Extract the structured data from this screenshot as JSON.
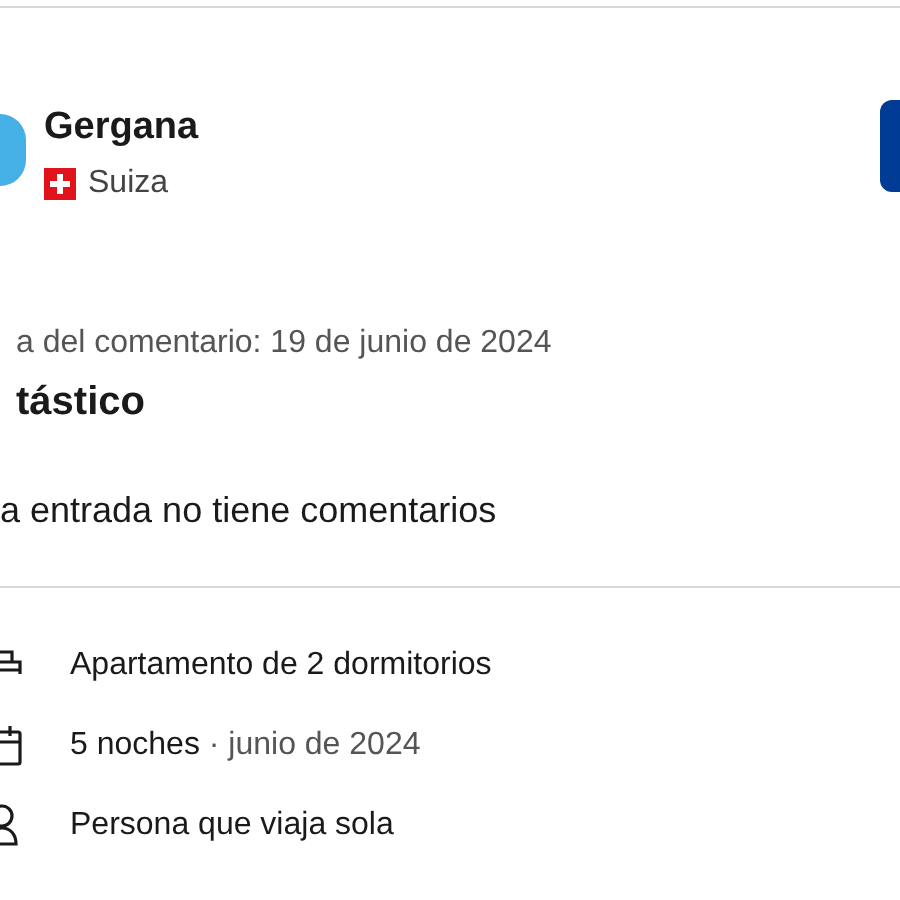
{
  "reviewer": {
    "name": "Gergana",
    "country": "Suiza"
  },
  "review": {
    "date": "a del comentario: 19 de junio de 2024",
    "title": "tástico",
    "body": "a entrada no tiene comentarios"
  },
  "details": [
    {
      "kind": "room",
      "text": "Apartamento de 2 dormitorios"
    },
    {
      "kind": "stay",
      "text": "5 noches",
      "extra": "· junio de 2024"
    },
    {
      "kind": "traveler",
      "text": "Persona que viaja sola"
    }
  ]
}
